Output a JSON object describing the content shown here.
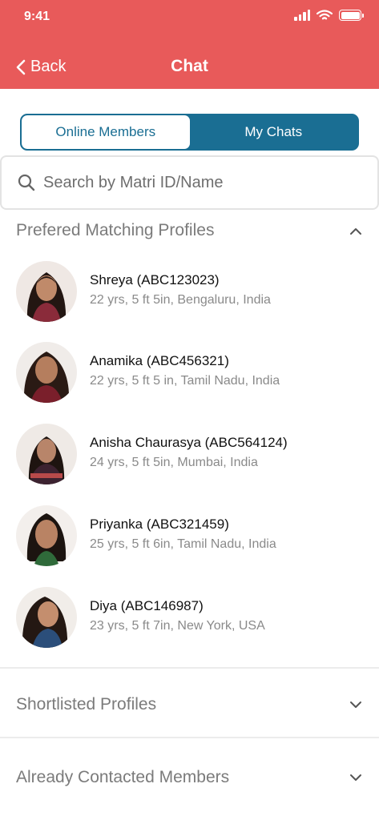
{
  "status_bar": {
    "time": "9:41",
    "icons": [
      "signal-icon",
      "wifi-icon",
      "battery-icon"
    ]
  },
  "header": {
    "back_label": "Back",
    "title": "Chat",
    "color": "#E85A5A"
  },
  "tabs": [
    {
      "label": "Online Members",
      "active": true
    },
    {
      "label": "My Chats",
      "active": false
    }
  ],
  "accent_color": "#1A6E93",
  "search": {
    "placeholder": "Search by Matri ID/Name"
  },
  "sections": {
    "preferred": {
      "title": "Prefered Matching Profiles",
      "expanded": true
    },
    "shortlisted": {
      "title": "Shortlisted Profiles",
      "expanded": false
    },
    "contacted": {
      "title": "Already Contacted Members",
      "expanded": false
    }
  },
  "profiles": [
    {
      "name": "Shreya (ABC123023)",
      "details": "22 yrs, 5 ft 5in, Bengaluru, India"
    },
    {
      "name": "Anamika (ABC456321)",
      "details": "22 yrs, 5 ft 5 in, Tamil Nadu, India"
    },
    {
      "name": "Anisha Chaurasya (ABC564124)",
      "details": "24 yrs, 5 ft 5in, Mumbai, India"
    },
    {
      "name": "Priyanka (ABC321459)",
      "details": "25 yrs, 5 ft 6in, Tamil Nadu, India"
    },
    {
      "name": "Diya (ABC146987)",
      "details": "23 yrs, 5 ft 7in, New York, USA"
    }
  ]
}
